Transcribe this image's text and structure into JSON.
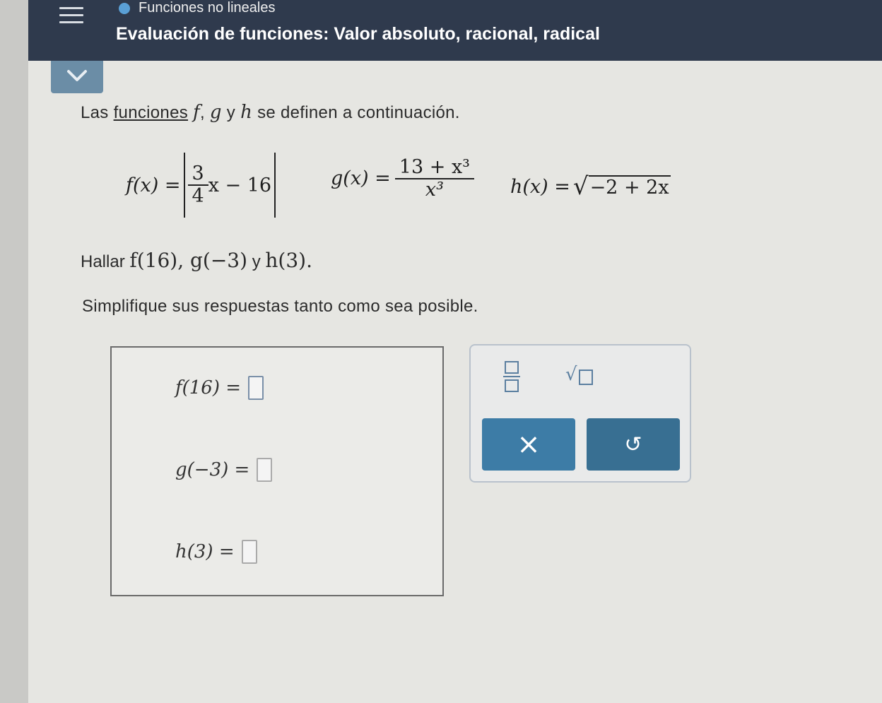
{
  "header": {
    "topic": "Funciones no lineales",
    "title": "Evaluación de funciones: Valor absoluto, racional, radical"
  },
  "problem": {
    "intro_prefix": "Las",
    "intro_link": "funciones",
    "intro_f": "f",
    "intro_g": "g",
    "intro_y": "y",
    "intro_h": "h",
    "intro_suffix": "se definen a continuación.",
    "f_def": {
      "lhs": "f(x) =",
      "num": "3",
      "den": "4",
      "rest": "x − 16"
    },
    "g_def": {
      "lhs": "g(x) =",
      "num": "13 + x³",
      "den": "x³"
    },
    "h_def": {
      "lhs": "h(x) =",
      "radicand": "−2 + 2x"
    },
    "find_label": "Hallar",
    "find_items": "f(16), g(−3)",
    "find_y": "y",
    "find_last": "h(3).",
    "instruction": "Simplifique sus respuestas tanto como sea posible."
  },
  "answers": [
    {
      "label": "f(16) =",
      "value": ""
    },
    {
      "label": "g(−3) =",
      "value": ""
    },
    {
      "label": "h(3) =",
      "value": ""
    }
  ],
  "palette": {
    "tools": [
      "fraction-tool",
      "sqrt-tool"
    ],
    "clear_label": "×",
    "undo_label": "↺"
  },
  "colors": {
    "header_bg": "#2f3a4d",
    "accent": "#3d7ca6"
  }
}
